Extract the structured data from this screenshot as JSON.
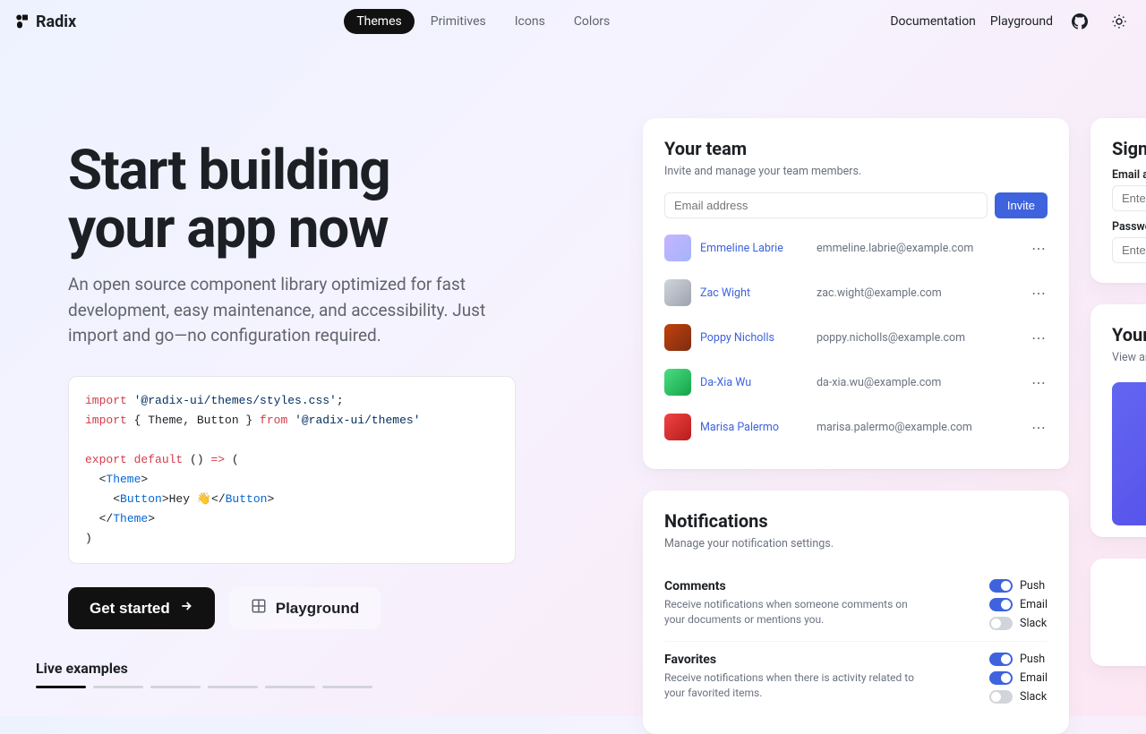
{
  "nav": {
    "logo": "Radix",
    "items": [
      "Themes",
      "Primitives",
      "Icons",
      "Colors"
    ],
    "active_index": 0,
    "right_links": [
      "Documentation",
      "Playground"
    ]
  },
  "hero": {
    "title_line1": "Start building",
    "title_line2": "your app now",
    "subtitle": "An open source component library optimized for fast development, easy maintenance, and accessibility. Just import and go—no configuration required.",
    "cta_primary": "Get started",
    "cta_secondary": "Playground",
    "live_examples_label": "Live examples"
  },
  "code": {
    "l1_kw": "import",
    "l1_str": "'@radix-ui/themes/styles.css'",
    "l1_end": ";",
    "l2_kw": "import",
    "l2_mid": " { Theme, Button } ",
    "l2_from": "from",
    "l2_str": " '@radix-ui/themes'",
    "l3_a": "export default",
    "l3_b": " () ",
    "l3_c": "=>",
    "l3_d": " (",
    "l4_a": "  <",
    "l4_b": "Theme",
    "l4_c": ">",
    "l5_a": "    <",
    "l5_b": "Button",
    "l5_c": ">Hey 👋</",
    "l5_d": "Button",
    "l5_e": ">",
    "l6_a": "  </",
    "l6_b": "Theme",
    "l6_c": ">",
    "l7": ")"
  },
  "team": {
    "title": "Your team",
    "subtitle": "Invite and manage your team members.",
    "email_placeholder": "Email address",
    "invite_label": "Invite",
    "members": [
      {
        "name": "Emmeline Labrie",
        "email": "emmeline.labrie@example.com"
      },
      {
        "name": "Zac Wight",
        "email": "zac.wight@example.com"
      },
      {
        "name": "Poppy Nicholls",
        "email": "poppy.nicholls@example.com"
      },
      {
        "name": "Da-Xia Wu",
        "email": "da-xia.wu@example.com"
      },
      {
        "name": "Marisa Palermo",
        "email": "marisa.palermo@example.com"
      }
    ]
  },
  "notifications": {
    "title": "Notifications",
    "subtitle": "Manage your notification settings.",
    "channels": [
      "Push",
      "Email",
      "Slack"
    ],
    "items": [
      {
        "title": "Comments",
        "desc": "Receive notifications when someone comments on your documents or mentions you.",
        "states": [
          true,
          true,
          false
        ]
      },
      {
        "title": "Favorites",
        "desc": "Receive notifications when there is activity related to your favorited items.",
        "states": [
          true,
          true,
          false
        ]
      }
    ]
  },
  "signup": {
    "title": "Sign",
    "email_label": "Email a",
    "email_placeholder": "Enter y",
    "password_label": "Passwo",
    "password_placeholder": "Enter y"
  },
  "profile": {
    "title": "Your",
    "subtitle": "View an"
  }
}
